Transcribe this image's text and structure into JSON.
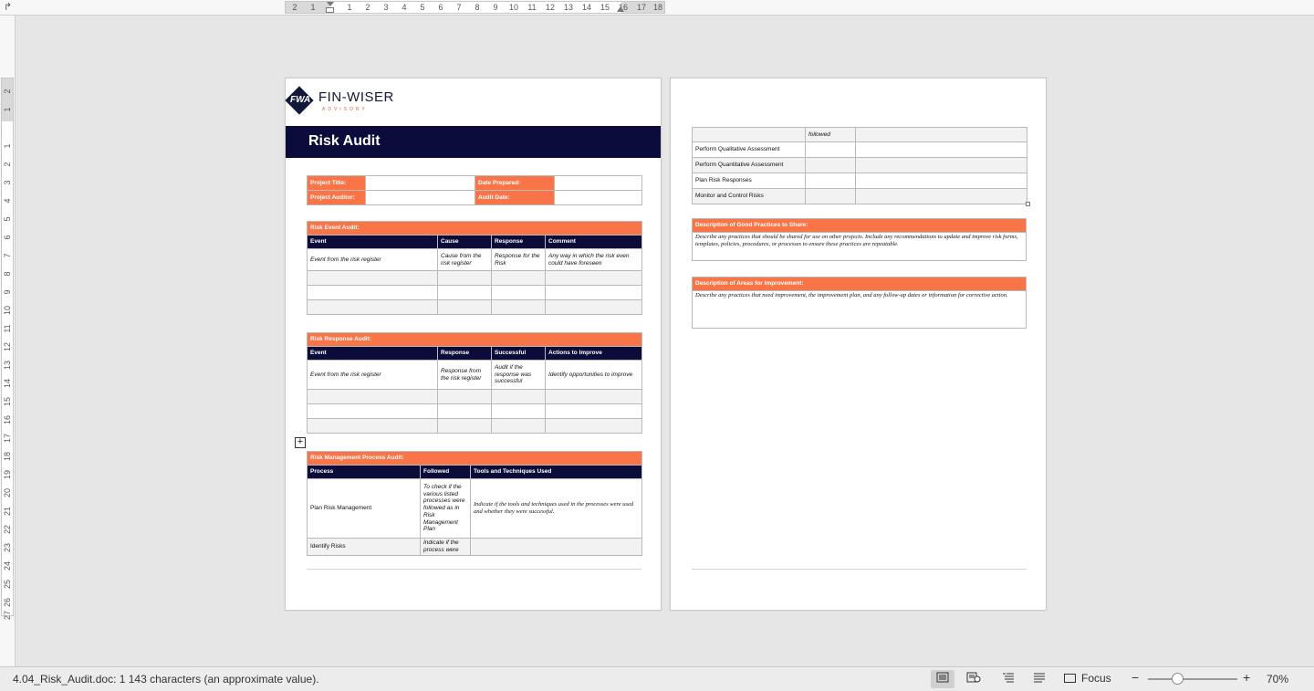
{
  "ruler": {
    "corner_icon": "return-arrow-icon",
    "h_numbers": [
      "2",
      "1",
      "1",
      "1",
      "2",
      "3",
      "4",
      "5",
      "6",
      "7",
      "8",
      "9",
      "10",
      "11",
      "12",
      "13",
      "14",
      "15",
      "16",
      "17",
      "18"
    ],
    "v_numbers": [
      "2",
      "1",
      "1",
      "2",
      "3",
      "4",
      "5",
      "6",
      "7",
      "8",
      "9",
      "10",
      "11",
      "12",
      "13",
      "14",
      "15",
      "16",
      "17",
      "18",
      "19",
      "20",
      "21",
      "22",
      "23",
      "24",
      "25",
      "26",
      "27"
    ]
  },
  "page1": {
    "logo": {
      "mark": "FWA",
      "brand": "FIN-WISER",
      "sub": "ADVISORY"
    },
    "title": "Risk Audit",
    "info": {
      "project_title_label": "Project Title:",
      "project_title_value": "",
      "date_prepared_label": "Date Prepared:",
      "date_prepared_value": "",
      "project_auditor_label": "Project Auditor:",
      "project_auditor_value": "",
      "audit_date_label": "Audit Date:",
      "audit_date_value": ""
    },
    "risk_event": {
      "title": "Risk Event Audit:",
      "headers": [
        "Event",
        "Cause",
        "Response",
        "Comment"
      ],
      "row1": [
        "Event from the risk register",
        "Cause from the risk register",
        "Response for the Risk",
        "Any way in which the risk even could have foreseen"
      ]
    },
    "risk_response": {
      "title": "Risk Response Audit:",
      "headers": [
        "Event",
        "Response",
        "Successful",
        "Actions to Improve"
      ],
      "row1": [
        "Event from the risk register",
        "Response from the risk register",
        "Audit if the response was successful",
        "Identify opportunities to improve"
      ]
    },
    "process": {
      "title": "Risk Management Process Audit:",
      "headers": [
        "Process",
        "Followed",
        "Tools and Techniques Used"
      ],
      "row1": [
        "Plan Risk Management",
        "To check if the various listed processes were followed as in Risk Management Plan",
        "Indicate if the tools and techniques used in the processes were used and whether they were successful."
      ],
      "row2": [
        "Identify Risks",
        "Indicate if the process were",
        ""
      ]
    }
  },
  "page2": {
    "continued_rows": [
      [
        "",
        "followed",
        ""
      ],
      [
        "Perform Qualitative Assessment",
        "",
        ""
      ],
      [
        "Perform Quantitative Assessment",
        "",
        ""
      ],
      [
        "Plan Risk Responses",
        "",
        ""
      ],
      [
        "Monitor and Control Risks",
        "",
        ""
      ]
    ],
    "good_practices": {
      "title": "Description of Good Practices to Share:",
      "text": "Describe any practices that should be shared for use on other projects. Include any recommendations to update and improve risk forms, templates, policies, procedures, or processes to ensure these practices are repeatable."
    },
    "improvement": {
      "title": "Description of Areas for Improvement:",
      "text": "Describe any practices that need improvement, the improvement plan, and any follow-up dates or information for corrective action."
    }
  },
  "status": {
    "doc_info": "4.04_Risk_Audit.doc: 1 143 characters (an approximate value).",
    "view_icons": [
      "print-layout-icon",
      "web-layout-icon",
      "outline-icon",
      "draft-icon"
    ],
    "focus_label": "Focus",
    "focus_icon": "focus-icon",
    "zoom": "70%",
    "zoom_level": 0.35
  }
}
